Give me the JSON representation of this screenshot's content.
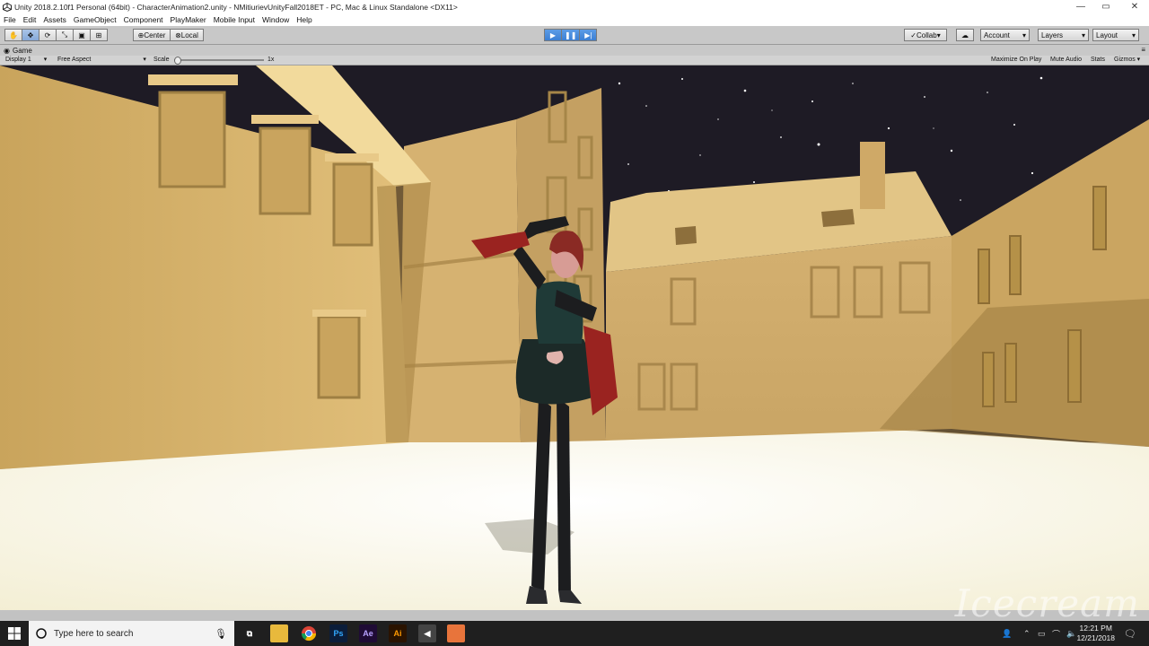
{
  "window": {
    "title": "Unity 2018.2.10f1 Personal (64bit) - CharacterAnimation2.unity - NMitiurievUnityFall2018ET - PC, Mac & Linux Standalone <DX11>",
    "controls": [
      "—",
      "▭",
      "✕"
    ]
  },
  "menu": {
    "items": [
      "File",
      "Edit",
      "Assets",
      "GameObject",
      "Component",
      "PlayMaker",
      "Mobile Input",
      "Window",
      "Help"
    ]
  },
  "toolbar": {
    "pivot_label": "Center",
    "space_label": "Local",
    "collab_label": "Collab",
    "account_label": "Account",
    "layers_label": "Layers",
    "layout_label": "Layout",
    "play_state": "playing"
  },
  "game_view": {
    "tab_label": "Game",
    "display_label": "Display 1",
    "aspect_label": "Free Aspect",
    "scale_label": "Scale",
    "scale_value": "1x",
    "maximize_label": "Maximize On Play",
    "mute_label": "Mute Audio",
    "stats_label": "Stats",
    "gizmos_label": "Gizmos"
  },
  "taskbar": {
    "search_placeholder": "Type here to search",
    "apps": [
      "file-explorer",
      "chrome",
      "photoshop",
      "after-effects",
      "illustrator",
      "unity",
      "icecream-recorder"
    ],
    "app_labels": {
      "ps": "Ps",
      "ae": "Ae",
      "ai": "Ai"
    },
    "time": "12:21 PM",
    "date": "12/21/2018"
  },
  "watermark": {
    "text": "Icecream"
  },
  "colors": {
    "building": "#d9b46c",
    "sky": "#1d1a24",
    "ground": "#f4f0d6",
    "dress": "#1f3a37",
    "ribbon": "#9a2320",
    "accent": "#3b7fd4"
  }
}
